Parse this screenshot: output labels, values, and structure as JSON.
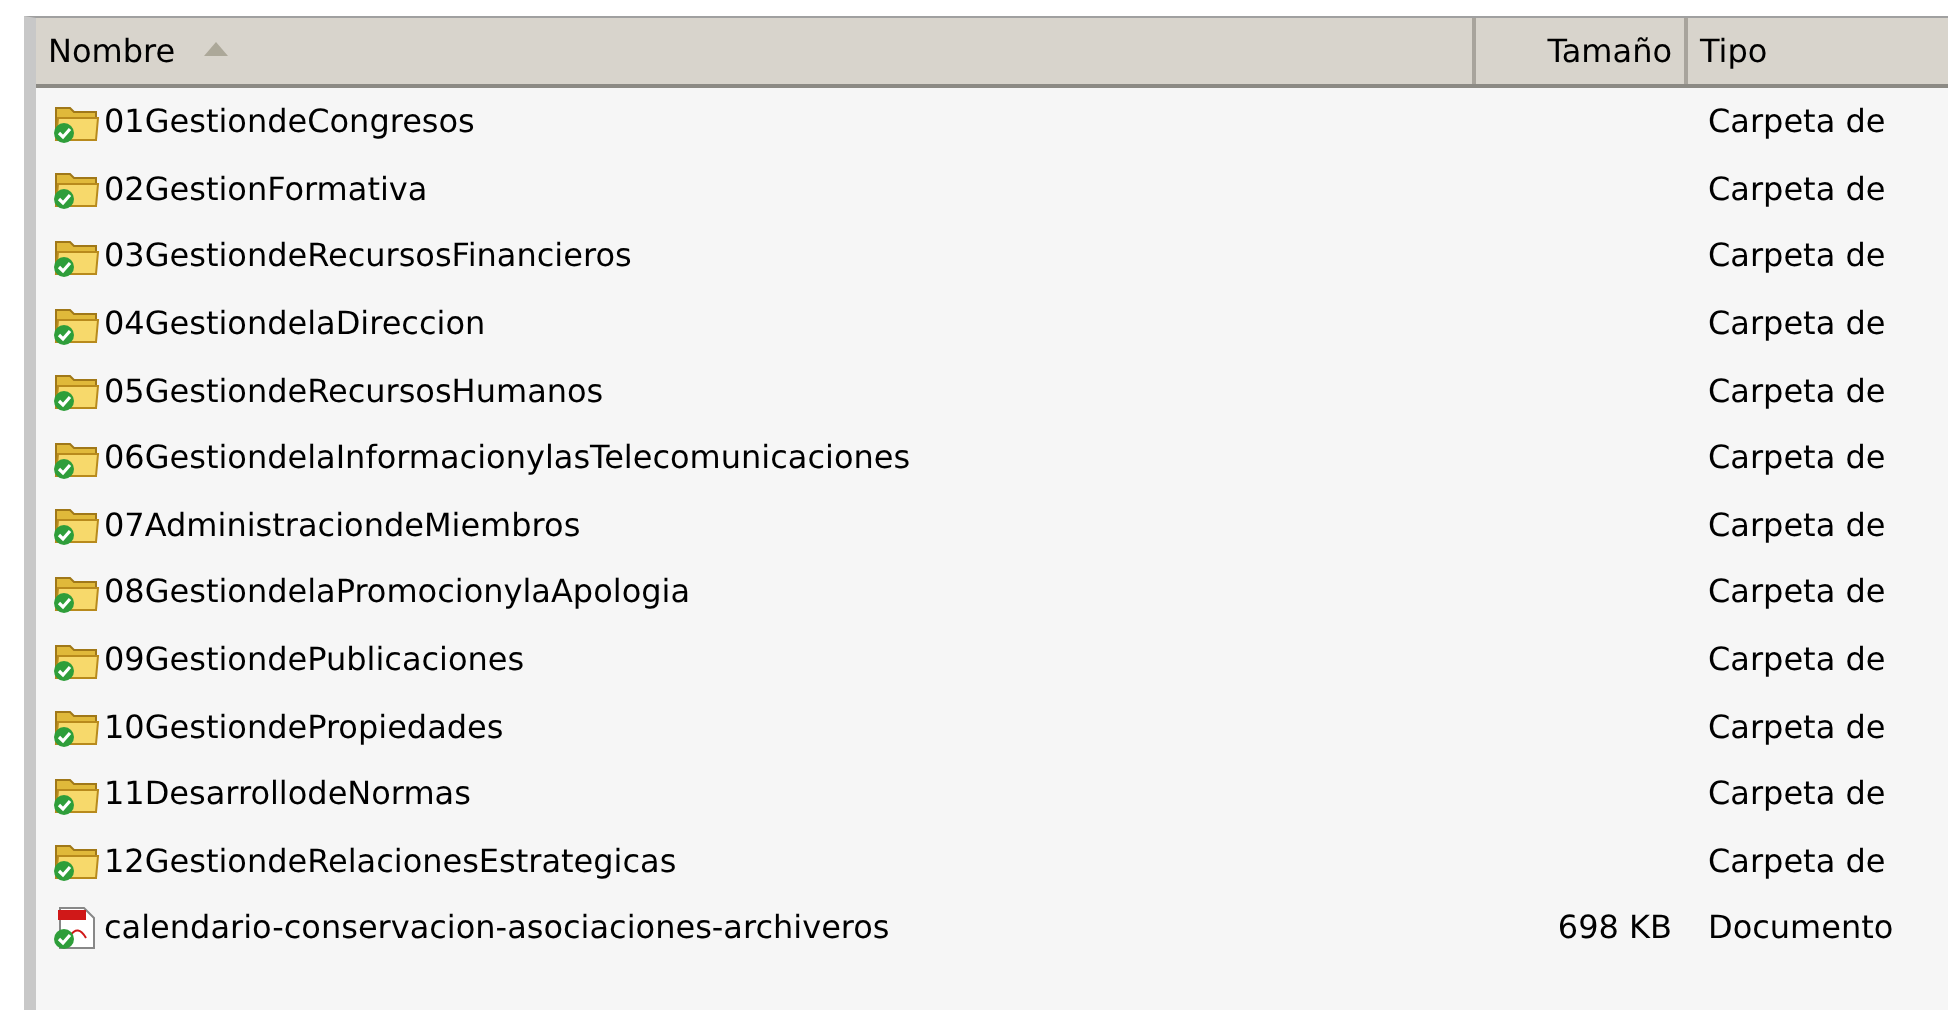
{
  "columns": [
    {
      "label": "Nombre",
      "sorted": true
    },
    {
      "label": "Tamaño",
      "sorted": false
    },
    {
      "label": "Tipo",
      "sorted": false
    }
  ],
  "rows": [
    {
      "kind": "folder",
      "name": "01GestiondeCongresos",
      "type": "Carpeta de"
    },
    {
      "kind": "folder",
      "name": "02GestionFormativa",
      "type": "Carpeta de"
    },
    {
      "kind": "folder",
      "name": "03GestiondeRecursosFinancieros",
      "type": "Carpeta de"
    },
    {
      "kind": "folder",
      "name": "04GestiondelaDireccion",
      "type": "Carpeta de"
    },
    {
      "kind": "folder",
      "name": "05GestiondeRecursosHumanos",
      "type": "Carpeta de"
    },
    {
      "kind": "folder",
      "name": "06GestiondelaInformacionylasTelecomunicaciones",
      "type": "Carpeta de"
    },
    {
      "kind": "folder",
      "name": "07AdministraciondeMiembros",
      "type": "Carpeta de"
    },
    {
      "kind": "folder",
      "name": "08GestiondelaPromocionylaApologia",
      "type": "Carpeta de"
    },
    {
      "kind": "folder",
      "name": "09GestiondePublicaciones",
      "type": "Carpeta de"
    },
    {
      "kind": "folder",
      "name": "10GestiondePropiedades",
      "type": "Carpeta de"
    },
    {
      "kind": "folder",
      "name": "11DesarrollodeNormas",
      "type": "Carpeta de"
    },
    {
      "kind": "folder",
      "name": "12GestiondeRelacionesEstrategicas",
      "type": "Carpeta de"
    },
    {
      "kind": "pdf",
      "name": "calendario-conservacion-asociaciones-archiveros",
      "size": "698 KB",
      "type": "Documento"
    }
  ]
}
